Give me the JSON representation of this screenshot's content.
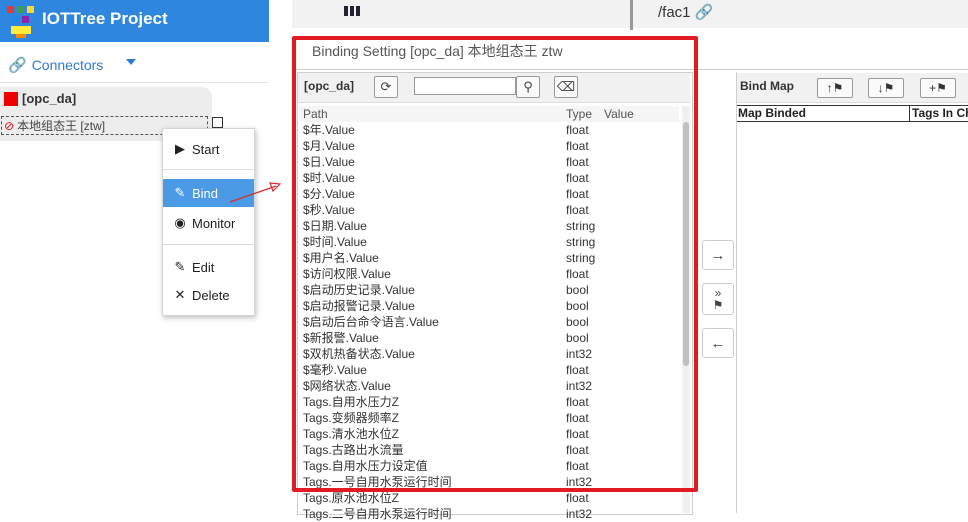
{
  "app": {
    "title": "IOTTree Project"
  },
  "sidebar": {
    "connectors_label": "Connectors",
    "connection": {
      "name": "[opc_da]",
      "item_label": "本地组态王 [ztw]"
    }
  },
  "context_menu": {
    "items": [
      {
        "label": "Start",
        "icon": "play-icon"
      },
      {
        "label": "Bind",
        "icon": "pencil-icon",
        "active": true
      },
      {
        "label": "Monitor",
        "icon": "eye-icon"
      },
      {
        "label": "Edit",
        "icon": "edit-icon"
      },
      {
        "label": "Delete",
        "icon": "close-icon"
      }
    ]
  },
  "background": {
    "top_text": "/fac1"
  },
  "dialog": {
    "title": "Binding Setting [opc_da] 本地组态王 ztw",
    "tag_panel": {
      "label": "[opc_da]",
      "search_placeholder": "",
      "columns": {
        "path": "Path",
        "type": "Type",
        "value": "Value"
      },
      "rows": [
        {
          "path": "$年.Value",
          "type": "float"
        },
        {
          "path": "$月.Value",
          "type": "float"
        },
        {
          "path": "$日.Value",
          "type": "float"
        },
        {
          "path": "$时.Value",
          "type": "float"
        },
        {
          "path": "$分.Value",
          "type": "float"
        },
        {
          "path": "$秒.Value",
          "type": "float"
        },
        {
          "path": "$日期.Value",
          "type": "string"
        },
        {
          "path": "$时间.Value",
          "type": "string"
        },
        {
          "path": "$用户名.Value",
          "type": "string"
        },
        {
          "path": "$访问权限.Value",
          "type": "float"
        },
        {
          "path": "$启动历史记录.Value",
          "type": "bool"
        },
        {
          "path": "$启动报警记录.Value",
          "type": "bool"
        },
        {
          "path": "$启动后台命令语言.Value",
          "type": "bool"
        },
        {
          "path": "$新报警.Value",
          "type": "bool"
        },
        {
          "path": "$双机热备状态.Value",
          "type": "int32"
        },
        {
          "path": "$毫秒.Value",
          "type": "float"
        },
        {
          "path": "$网络状态.Value",
          "type": "int32"
        },
        {
          "path": "Tags.自用水压力Z",
          "type": "float"
        },
        {
          "path": "Tags.变频器频率Z",
          "type": "float"
        },
        {
          "path": "Tags.清水池水位Z",
          "type": "float"
        },
        {
          "path": "Tags.古路出水流量",
          "type": "float"
        },
        {
          "path": "Tags.自用水压力设定值",
          "type": "float"
        },
        {
          "path": "Tags.一号自用水泵运行时间",
          "type": "int32"
        },
        {
          "path": "Tags.原水池水位Z",
          "type": "float"
        },
        {
          "path": "Tags.二号自用水泵运行时间",
          "type": "int32"
        }
      ]
    },
    "bind_map": {
      "title": "Bind Map",
      "columns": {
        "map_binded": "Map Binded",
        "tags_in": "Tags In Ch"
      }
    }
  },
  "colors": {
    "header_blue": "#2e86de",
    "highlight_red": "#e01b24",
    "menu_active": "#4a9ae6",
    "link_blue": "#2e7bd4"
  }
}
